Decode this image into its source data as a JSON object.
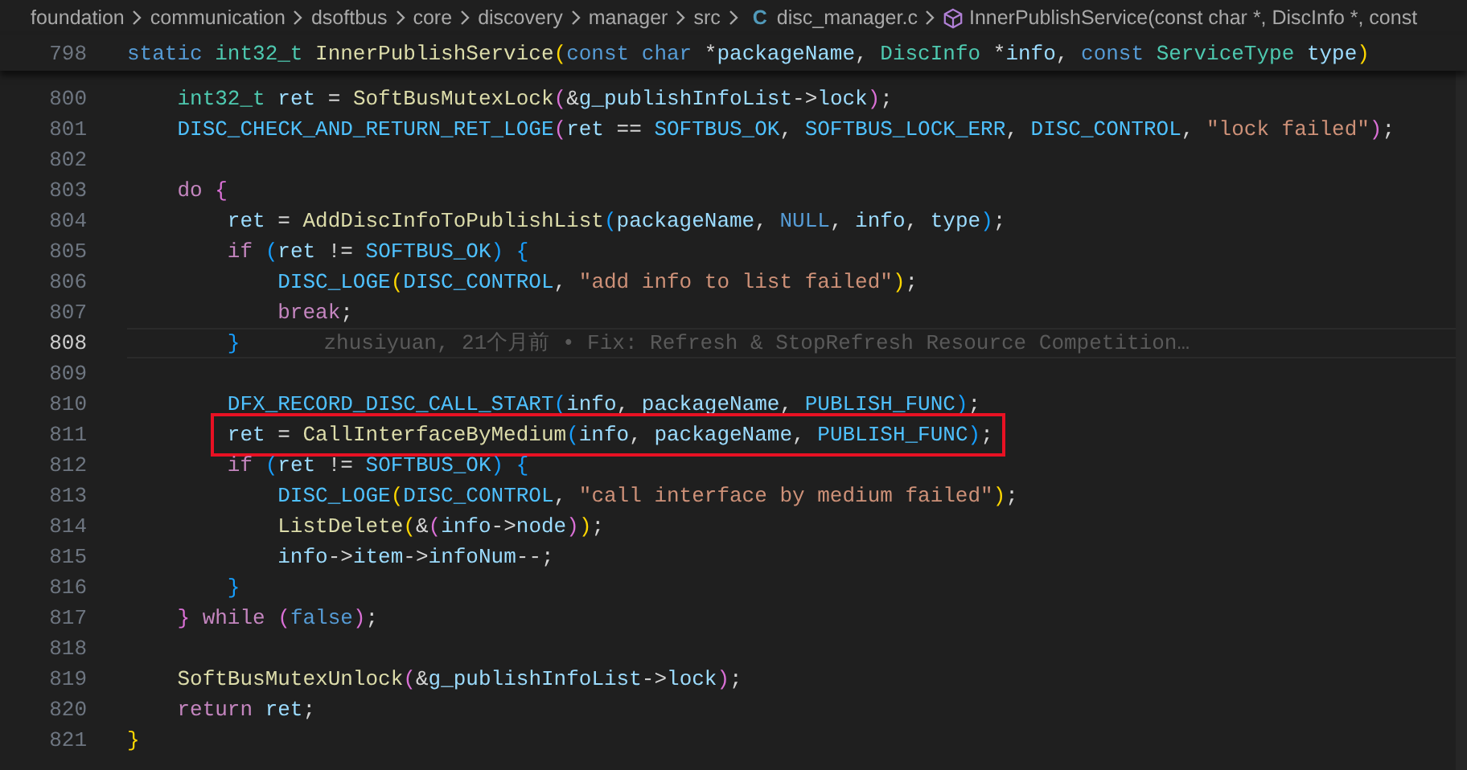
{
  "breadcrumb": {
    "folders": [
      "foundation",
      "communication",
      "dsoftbus",
      "core",
      "discovery",
      "manager",
      "src"
    ],
    "file": {
      "icon_glyph": "C",
      "name": "disc_manager.c"
    },
    "symbol": "InnerPublishService(const char *, DiscInfo *, const"
  },
  "sticky_line": {
    "number": "798",
    "tokens": [
      {
        "text": "static ",
        "kind": "k"
      },
      {
        "text": "int32_t ",
        "kind": "t"
      },
      {
        "text": "InnerPublishService",
        "kind": "f"
      },
      {
        "text": "(",
        "kind": "b1"
      },
      {
        "text": "const ",
        "kind": "k"
      },
      {
        "text": "char",
        "kind": "k"
      },
      {
        "text": " *",
        "kind": "p"
      },
      {
        "text": "packageName",
        "kind": "v"
      },
      {
        "text": ", ",
        "kind": "p"
      },
      {
        "text": "DiscInfo",
        "kind": "t"
      },
      {
        "text": " *",
        "kind": "p"
      },
      {
        "text": "info",
        "kind": "v"
      },
      {
        "text": ", ",
        "kind": "p"
      },
      {
        "text": "const ",
        "kind": "k"
      },
      {
        "text": "ServiceType ",
        "kind": "t"
      },
      {
        "text": "type",
        "kind": "v"
      },
      {
        "text": ")",
        "kind": "b1"
      }
    ]
  },
  "lines": [
    {
      "number": "800",
      "current": false,
      "highlighted": false,
      "tokens": [
        {
          "text": "    int32_t ",
          "kind": "t"
        },
        {
          "text": "ret",
          "kind": "v"
        },
        {
          "text": " = ",
          "kind": "p"
        },
        {
          "text": "SoftBusMutexLock",
          "kind": "f"
        },
        {
          "text": "(",
          "kind": "b2"
        },
        {
          "text": "&",
          "kind": "p"
        },
        {
          "text": "g_publishInfoList",
          "kind": "v"
        },
        {
          "text": "->",
          "kind": "p"
        },
        {
          "text": "lock",
          "kind": "v"
        },
        {
          "text": ")",
          "kind": "b2"
        },
        {
          "text": ";",
          "kind": "p"
        }
      ]
    },
    {
      "number": "801",
      "current": false,
      "highlighted": false,
      "tokens": [
        {
          "text": "    DISC_CHECK_AND_RETURN_RET_LOGE",
          "kind": "m"
        },
        {
          "text": "(",
          "kind": "b2"
        },
        {
          "text": "ret",
          "kind": "v"
        },
        {
          "text": " == ",
          "kind": "p"
        },
        {
          "text": "SOFTBUS_OK",
          "kind": "m"
        },
        {
          "text": ", ",
          "kind": "p"
        },
        {
          "text": "SOFTBUS_LOCK_ERR",
          "kind": "m"
        },
        {
          "text": ", ",
          "kind": "p"
        },
        {
          "text": "DISC_CONTROL",
          "kind": "m"
        },
        {
          "text": ", ",
          "kind": "p"
        },
        {
          "text": "\"lock failed\"",
          "kind": "s"
        },
        {
          "text": ")",
          "kind": "b2"
        },
        {
          "text": ";",
          "kind": "p"
        }
      ]
    },
    {
      "number": "802",
      "current": false
    },
    {
      "number": "803",
      "current": false,
      "highlighted": false,
      "tokens": [
        {
          "text": "    do ",
          "kind": "c"
        },
        {
          "text": "{",
          "kind": "b2"
        }
      ]
    },
    {
      "number": "804",
      "current": false,
      "highlighted": false,
      "tokens": [
        {
          "text": "        ret",
          "kind": "v"
        },
        {
          "text": " = ",
          "kind": "p"
        },
        {
          "text": "AddDiscInfoToPublishList",
          "kind": "f"
        },
        {
          "text": "(",
          "kind": "b3"
        },
        {
          "text": "packageName",
          "kind": "v"
        },
        {
          "text": ", ",
          "kind": "p"
        },
        {
          "text": "NULL",
          "kind": "k"
        },
        {
          "text": ", ",
          "kind": "p"
        },
        {
          "text": "info",
          "kind": "v"
        },
        {
          "text": ", ",
          "kind": "p"
        },
        {
          "text": "type",
          "kind": "v"
        },
        {
          "text": ")",
          "kind": "b3"
        },
        {
          "text": ";",
          "kind": "p"
        }
      ]
    },
    {
      "number": "805",
      "current": false,
      "highlighted": false,
      "tokens": [
        {
          "text": "        if ",
          "kind": "c"
        },
        {
          "text": "(",
          "kind": "b3"
        },
        {
          "text": "ret",
          "kind": "v"
        },
        {
          "text": " != ",
          "kind": "p"
        },
        {
          "text": "SOFTBUS_OK",
          "kind": "m"
        },
        {
          "text": ") {",
          "kind": "b3"
        }
      ]
    },
    {
      "number": "806",
      "current": false,
      "highlighted": false,
      "tokens": [
        {
          "text": "            DISC_LOGE",
          "kind": "m"
        },
        {
          "text": "(",
          "kind": "b1"
        },
        {
          "text": "DISC_CONTROL",
          "kind": "m"
        },
        {
          "text": ", ",
          "kind": "p"
        },
        {
          "text": "\"add info to list failed\"",
          "kind": "s"
        },
        {
          "text": ")",
          "kind": "b1"
        },
        {
          "text": ";",
          "kind": "p"
        }
      ]
    },
    {
      "number": "807",
      "current": false,
      "highlighted": false,
      "tokens": [
        {
          "text": "            break",
          "kind": "c"
        },
        {
          "text": ";",
          "kind": "p"
        }
      ]
    },
    {
      "number": "808",
      "current": true,
      "highlighted": false,
      "tokens": [
        {
          "text": "        }",
          "kind": "b3"
        }
      ],
      "blame": "zhusiyuan, 21个月前 • Fix: Refresh & StopRefresh Resource Competition…"
    },
    {
      "number": "809",
      "current": false
    },
    {
      "number": "810",
      "current": false,
      "highlighted": false,
      "tokens": [
        {
          "text": "        DFX_RECORD_DISC_CALL_START",
          "kind": "m"
        },
        {
          "text": "(",
          "kind": "b3"
        },
        {
          "text": "info",
          "kind": "v"
        },
        {
          "text": ", ",
          "kind": "p"
        },
        {
          "text": "packageName",
          "kind": "v"
        },
        {
          "text": ", ",
          "kind": "p"
        },
        {
          "text": "PUBLISH_FUNC",
          "kind": "m"
        },
        {
          "text": ")",
          "kind": "b3"
        },
        {
          "text": ";",
          "kind": "p"
        }
      ]
    },
    {
      "number": "811",
      "current": false,
      "highlighted": true,
      "tokens": [
        {
          "text": "        ret",
          "kind": "v"
        },
        {
          "text": " = ",
          "kind": "p"
        },
        {
          "text": "CallInterfaceByMedium",
          "kind": "f"
        },
        {
          "text": "(",
          "kind": "b3"
        },
        {
          "text": "info",
          "kind": "v"
        },
        {
          "text": ", ",
          "kind": "p"
        },
        {
          "text": "packageName",
          "kind": "v"
        },
        {
          "text": ", ",
          "kind": "p"
        },
        {
          "text": "PUBLISH_FUNC",
          "kind": "m"
        },
        {
          "text": ")",
          "kind": "b3"
        },
        {
          "text": ";",
          "kind": "p"
        }
      ]
    },
    {
      "number": "812",
      "current": false,
      "highlighted": false,
      "tokens": [
        {
          "text": "        if ",
          "kind": "c"
        },
        {
          "text": "(",
          "kind": "b3"
        },
        {
          "text": "ret",
          "kind": "v"
        },
        {
          "text": " != ",
          "kind": "p"
        },
        {
          "text": "SOFTBUS_OK",
          "kind": "m"
        },
        {
          "text": ") {",
          "kind": "b3"
        }
      ]
    },
    {
      "number": "813",
      "current": false,
      "highlighted": false,
      "tokens": [
        {
          "text": "            DISC_LOGE",
          "kind": "m"
        },
        {
          "text": "(",
          "kind": "b1"
        },
        {
          "text": "DISC_CONTROL",
          "kind": "m"
        },
        {
          "text": ", ",
          "kind": "p"
        },
        {
          "text": "\"call interface by medium failed\"",
          "kind": "s"
        },
        {
          "text": ")",
          "kind": "b1"
        },
        {
          "text": ";",
          "kind": "p"
        }
      ]
    },
    {
      "number": "814",
      "current": false,
      "highlighted": false,
      "tokens": [
        {
          "text": "            ListDelete",
          "kind": "f"
        },
        {
          "text": "(",
          "kind": "b1"
        },
        {
          "text": "&",
          "kind": "p"
        },
        {
          "text": "(",
          "kind": "b2"
        },
        {
          "text": "info",
          "kind": "v"
        },
        {
          "text": "->",
          "kind": "p"
        },
        {
          "text": "node",
          "kind": "v"
        },
        {
          "text": ")",
          "kind": "b2"
        },
        {
          "text": ")",
          "kind": "b1"
        },
        {
          "text": ";",
          "kind": "p"
        }
      ]
    },
    {
      "number": "815",
      "current": false,
      "highlighted": false,
      "tokens": [
        {
          "text": "            info",
          "kind": "v"
        },
        {
          "text": "->",
          "kind": "p"
        },
        {
          "text": "item",
          "kind": "v"
        },
        {
          "text": "->",
          "kind": "p"
        },
        {
          "text": "infoNum",
          "kind": "v"
        },
        {
          "text": "--;",
          "kind": "p"
        }
      ]
    },
    {
      "number": "816",
      "current": false,
      "highlighted": false,
      "tokens": [
        {
          "text": "        }",
          "kind": "b3"
        }
      ]
    },
    {
      "number": "817",
      "current": false,
      "highlighted": false,
      "tokens": [
        {
          "text": "    }",
          "kind": "b2"
        },
        {
          "text": " while ",
          "kind": "c"
        },
        {
          "text": "(",
          "kind": "b2"
        },
        {
          "text": "false",
          "kind": "k"
        },
        {
          "text": ")",
          "kind": "b2"
        },
        {
          "text": ";",
          "kind": "p"
        }
      ]
    },
    {
      "number": "818",
      "current": false
    },
    {
      "number": "819",
      "current": false,
      "highlighted": false,
      "tokens": [
        {
          "text": "    SoftBusMutexUnlock",
          "kind": "f"
        },
        {
          "text": "(",
          "kind": "b2"
        },
        {
          "text": "&",
          "kind": "p"
        },
        {
          "text": "g_publishInfoList",
          "kind": "v"
        },
        {
          "text": "->",
          "kind": "p"
        },
        {
          "text": "lock",
          "kind": "v"
        },
        {
          "text": ")",
          "kind": "b2"
        },
        {
          "text": ";",
          "kind": "p"
        }
      ]
    },
    {
      "number": "820",
      "current": false,
      "highlighted": false,
      "tokens": [
        {
          "text": "    return ",
          "kind": "c"
        },
        {
          "text": "ret",
          "kind": "v"
        },
        {
          "text": ";",
          "kind": "p"
        }
      ]
    },
    {
      "number": "821",
      "current": false,
      "highlighted": false,
      "tokens": [
        {
          "text": "}",
          "kind": "b1"
        }
      ]
    }
  ]
}
